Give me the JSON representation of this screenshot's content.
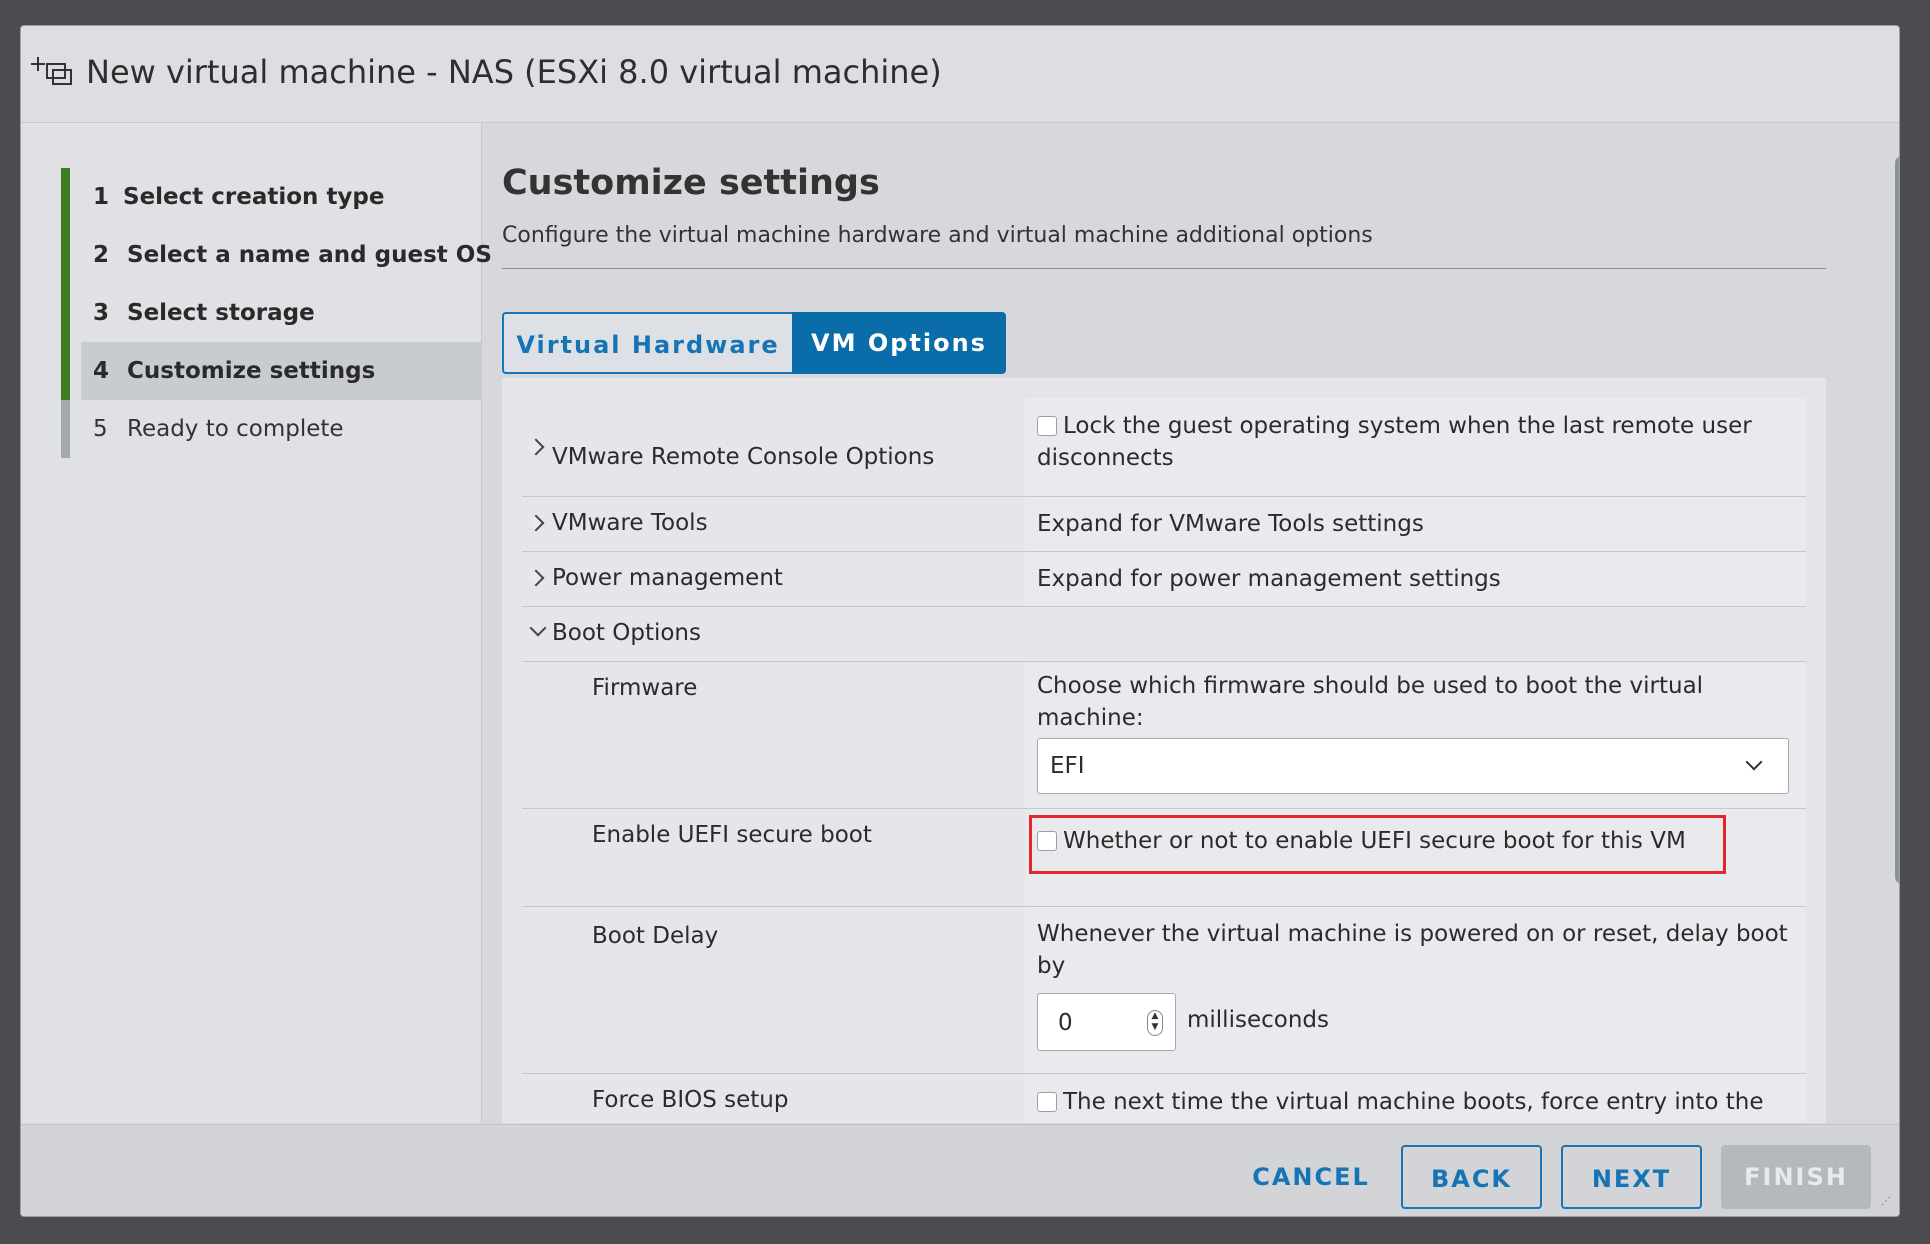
{
  "window": {
    "title": "New virtual machine - NAS (ESXi 8.0 virtual machine)"
  },
  "nav": {
    "items": [
      {
        "num": "1",
        "label": "Select creation type"
      },
      {
        "num": "2",
        "label": "Select a name and guest OS"
      },
      {
        "num": "3",
        "label": "Select storage"
      },
      {
        "num": "4",
        "label": "Customize settings"
      },
      {
        "num": "5",
        "label": "Ready to complete"
      }
    ]
  },
  "main": {
    "heading": "Customize settings",
    "subheading": "Configure the virtual machine hardware and virtual machine additional options",
    "tabs": [
      {
        "label": "Virtual Hardware"
      },
      {
        "label": "VM Options"
      }
    ]
  },
  "options": {
    "remote_console": {
      "label": "VMware Remote Console Options",
      "text": "Lock the guest operating system when the last remote user disconnects"
    },
    "tools": {
      "label": "VMware Tools",
      "text": "Expand for VMware Tools settings"
    },
    "power": {
      "label": "Power management",
      "text": "Expand for power management settings"
    },
    "boot": {
      "label": "Boot Options"
    },
    "firmware": {
      "label": "Firmware",
      "text": "Choose which firmware should be used to boot the virtual machine:",
      "value": "EFI"
    },
    "secure_boot": {
      "label": "Enable UEFI secure boot",
      "text": "Whether or not to enable UEFI secure boot for this VM"
    },
    "boot_delay": {
      "label": "Boot Delay",
      "text": "Whenever the virtual machine is powered on or reset, delay boot by",
      "value": "0",
      "unit": "milliseconds"
    },
    "force_bios": {
      "label": "Force BIOS setup",
      "text": "The next time the virtual machine boots, force entry into the BIOS setup screen."
    }
  },
  "footer": {
    "cancel": "CANCEL",
    "back": "BACK",
    "next": "NEXT",
    "finish": "FINISH"
  },
  "colors": {
    "accent": "#0a6ca8",
    "nav_done": "#3c7d1f",
    "highlight": "#e3262b"
  }
}
